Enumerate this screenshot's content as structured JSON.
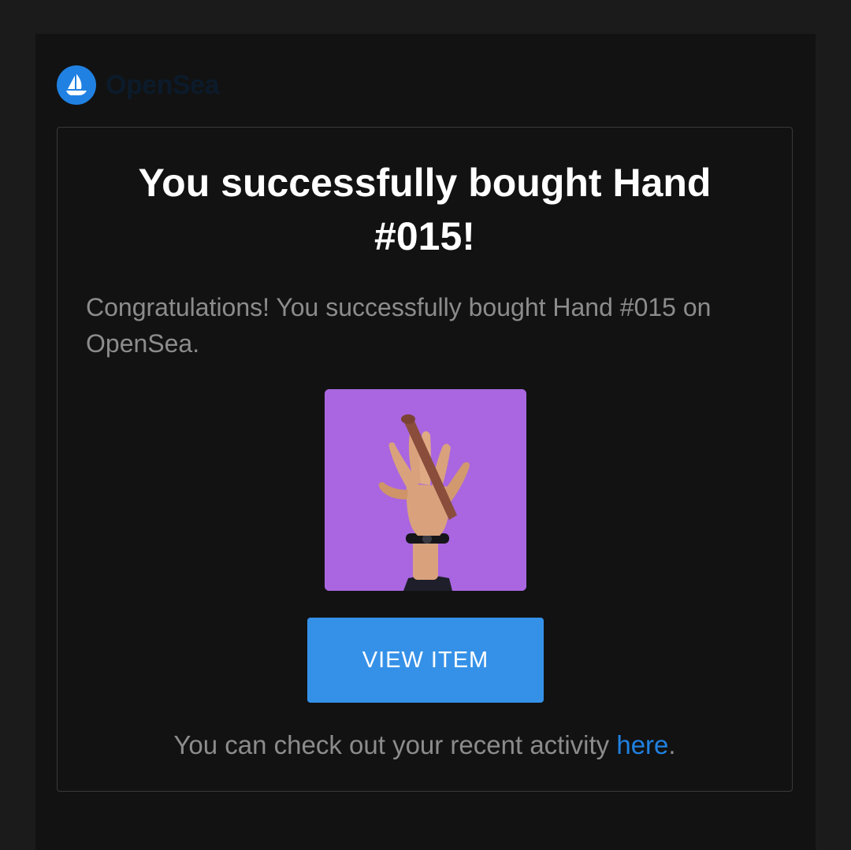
{
  "brand": {
    "name": "OpenSea",
    "accent_color": "#2081e2",
    "logo_icon": "sailboat-icon"
  },
  "card": {
    "title": "You successfully bought Hand #015!",
    "message": "Congratulations! You successfully bought Hand #015 on OpenSea.",
    "image": {
      "icon": "hand-nft-image",
      "background_color": "#a966e0"
    },
    "button": {
      "label": "VIEW ITEM",
      "color": "#3591e8"
    },
    "footer": {
      "text": "You can check out your recent activity ",
      "link_label": "here",
      "suffix": "."
    }
  }
}
